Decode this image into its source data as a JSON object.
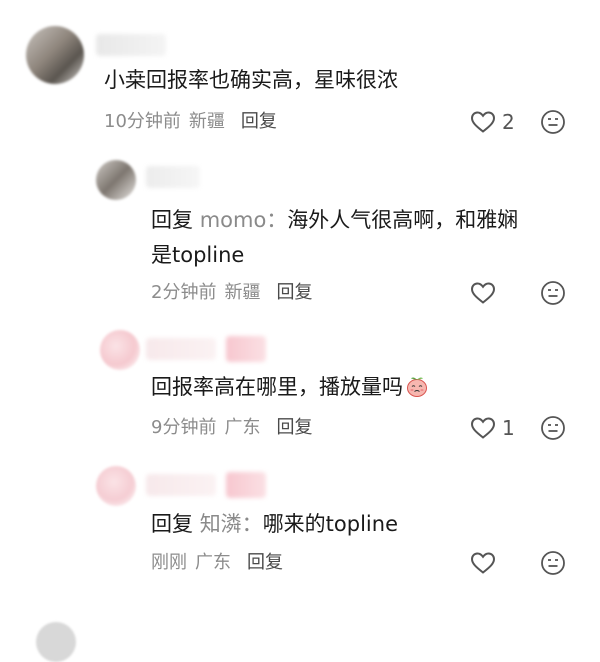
{
  "comments": [
    {
      "text": "小桒回报率也确实高，星味很浓",
      "time": "10分钟前",
      "location": "新疆",
      "reply_label": "回复",
      "likes": "2"
    },
    {
      "reply_prefix": "回复",
      "reply_target": "momo：",
      "text_line1": "海外人气很高啊，和雅娴",
      "text_line2": "是topline",
      "time": "2分钟前",
      "location": "新疆",
      "reply_label": "回复",
      "likes": ""
    },
    {
      "text": "回报率高在哪里，播放量吗",
      "emoji": "peach-face-emoji",
      "time": "9分钟前",
      "location": "广东",
      "reply_label": "回复",
      "likes": "1"
    },
    {
      "reply_prefix": "回复",
      "reply_target": "知潾：",
      "text": "哪来的topline",
      "time": "刚刚",
      "location": "广东",
      "reply_label": "回复",
      "likes": ""
    }
  ],
  "icons": {
    "like": "heart-outline-icon",
    "dislike": "meh-face-icon"
  },
  "colors": {
    "text": "#1a1a1a",
    "meta": "#8c8c8c",
    "reply_target": "#8a8a8a",
    "icon": "#555555"
  }
}
